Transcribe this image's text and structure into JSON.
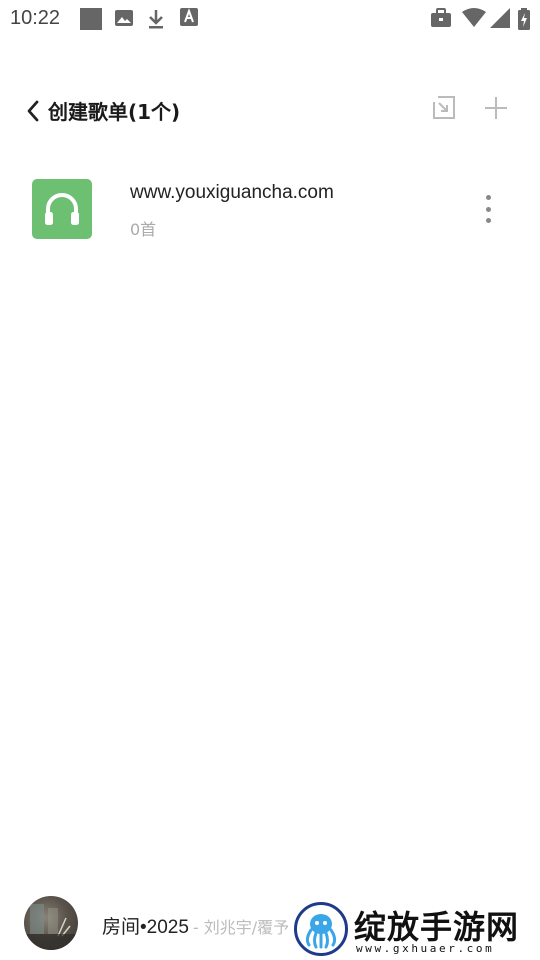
{
  "status_bar": {
    "time": "10:22",
    "icons": [
      "square-notification-icon",
      "image-icon",
      "download-icon",
      "a-font-icon",
      "briefcase-icon",
      "wifi-icon",
      "signal-icon",
      "battery-icon"
    ]
  },
  "header": {
    "title": "创建歌单(1个)"
  },
  "playlists": [
    {
      "name": "www.youxiguancha.com",
      "count": "0首",
      "cover_color": "#6dbf72"
    }
  ],
  "player": {
    "song": "房间•2025",
    "artist": "- 刘兆宇/覆予"
  },
  "watermark": {
    "title": "绽放手游网",
    "url": "www.gxhuaer.com"
  }
}
